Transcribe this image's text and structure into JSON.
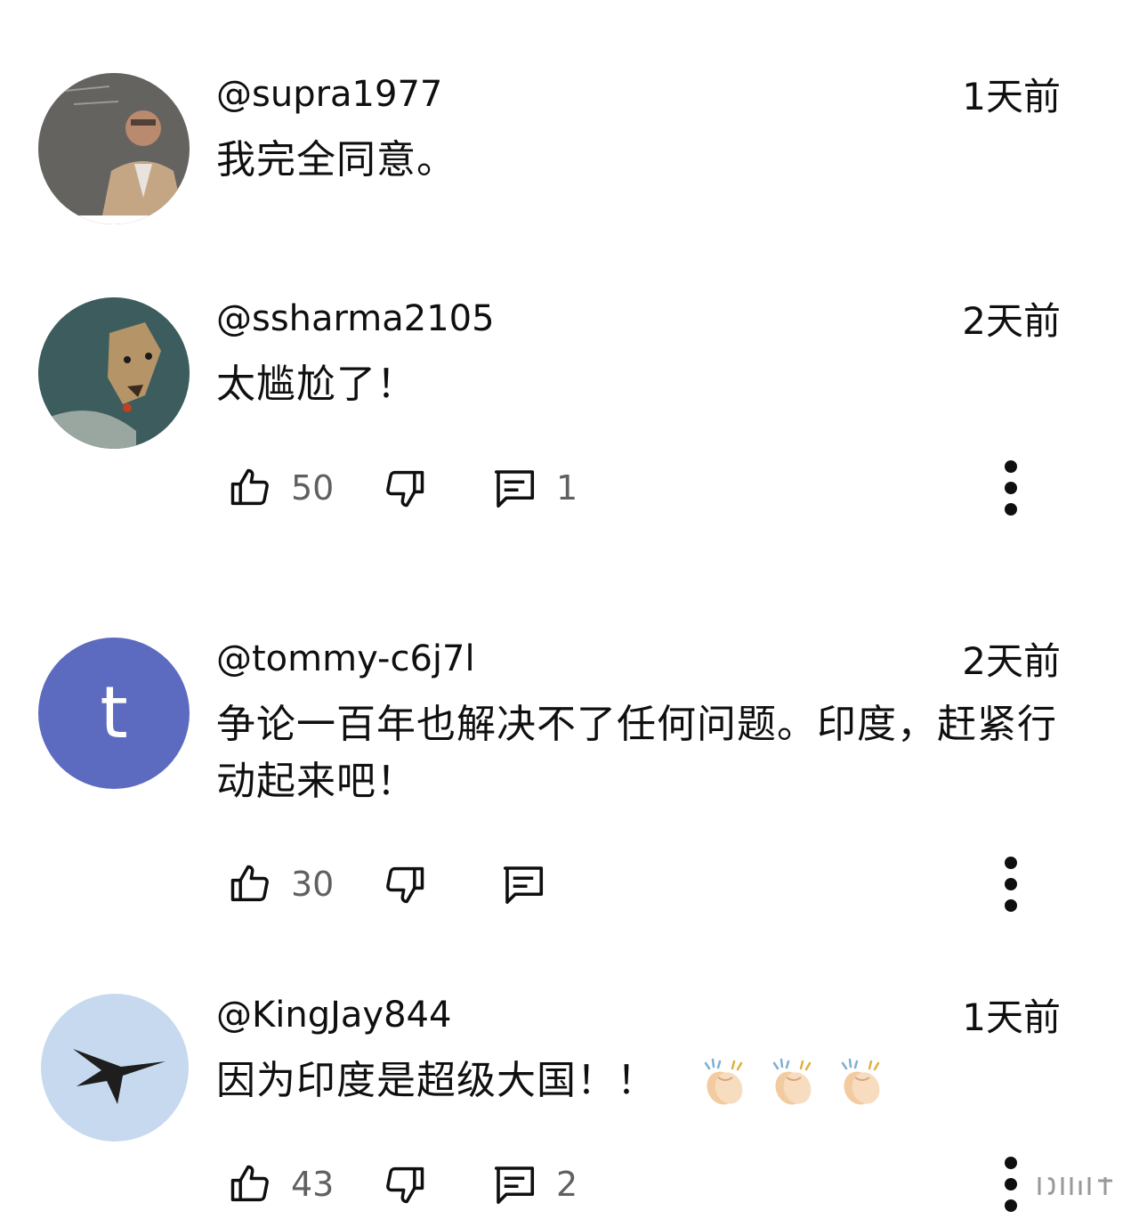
{
  "comments": [
    {
      "username": "@supra1977",
      "time": "1天前",
      "text": "我完全同意。",
      "avatar": "photo-man-in-suit",
      "actions": null
    },
    {
      "username": "@ssharma2105",
      "time": "2天前",
      "text": "太尴尬了！",
      "avatar": "photo-dog",
      "actions": {
        "likes": "50",
        "replies": "1"
      }
    },
    {
      "username": "@tommy-c6j7l",
      "time": "2天前",
      "text": "争论一百年也解决不了任何问题。印度，赶紧行动起来吧！",
      "avatar_letter": "t",
      "avatar_color": "#5c6bc0",
      "actions": {
        "likes": "30",
        "replies": ""
      }
    },
    {
      "username": "@KingJay844",
      "time": "1天前",
      "text": "因为印度是超级大国！！",
      "emoji": "clapping-hands x3",
      "avatar": "photo-jet-in-sky",
      "actions": {
        "likes": "43",
        "replies": "2"
      }
    }
  ],
  "colors": {
    "text": "#0f0f0f",
    "secondary": "#606060",
    "icon": "#0f0f0f"
  }
}
